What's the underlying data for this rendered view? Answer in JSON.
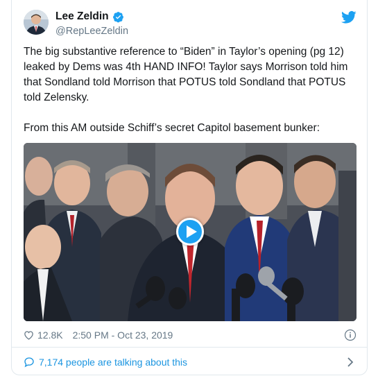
{
  "user": {
    "name": "Lee Zeldin",
    "handle": "@RepLeeZeldin"
  },
  "tweet": {
    "text": "The big substantive reference to “Biden” in Taylor’s opening (pg 12) leaked by Dems was 4th HAND INFO! Taylor says Morrison told him that Sondland told Morrison that POTUS told Sondland that POTUS told Zelensky.\n\nFrom this AM outside Schiff’s secret Capitol basement bunker:"
  },
  "media": {
    "type": "video",
    "play_icon": "play-icon"
  },
  "meta": {
    "likes": "12.8K",
    "timestamp": "2:50 PM - Oct 23, 2019"
  },
  "footer": {
    "talking": "7,174 people are talking about this"
  },
  "icons": {
    "verified": "verified-badge-icon",
    "brand": "twitter-bird-icon",
    "like": "heart-icon",
    "info": "info-icon",
    "reply": "speech-bubble-icon",
    "more": "chevron-right-icon"
  },
  "colors": {
    "accent": "#1da1f2",
    "link": "#1b95e0",
    "text": "#14171a",
    "muted": "#657786",
    "tie_red": "#c0262d"
  }
}
